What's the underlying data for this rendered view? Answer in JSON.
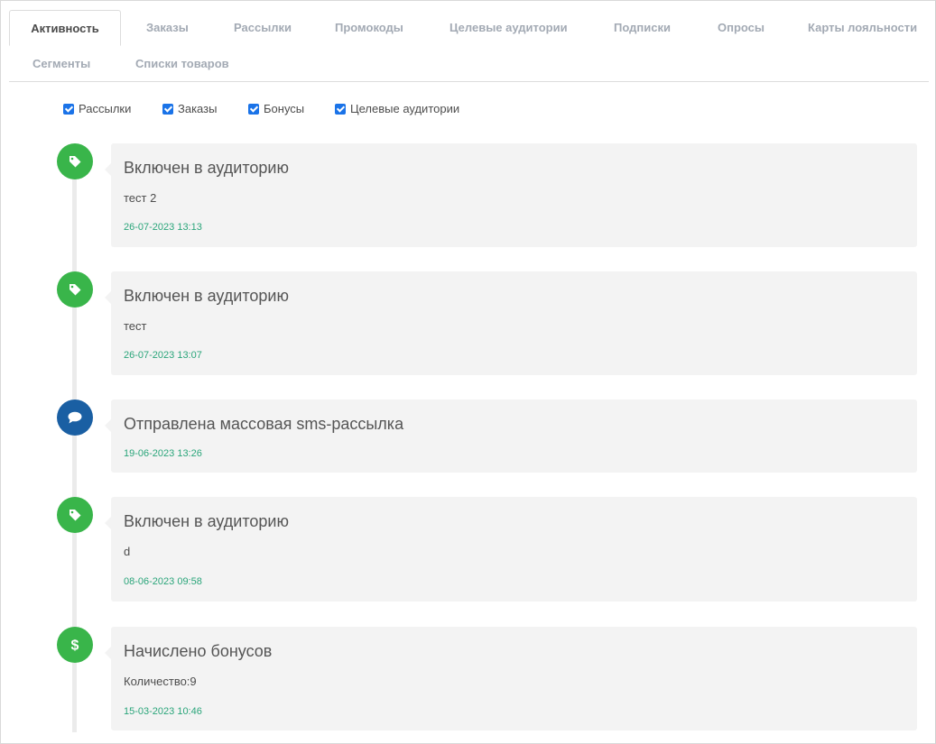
{
  "tabs": [
    {
      "label": "Активность",
      "active": true
    },
    {
      "label": "Заказы",
      "active": false
    },
    {
      "label": "Рассылки",
      "active": false
    },
    {
      "label": "Промокоды",
      "active": false
    },
    {
      "label": "Целевые аудитории",
      "active": false
    },
    {
      "label": "Подписки",
      "active": false
    },
    {
      "label": "Опросы",
      "active": false
    },
    {
      "label": "Карты лояльности",
      "active": false
    },
    {
      "label": "Сегменты",
      "active": false
    },
    {
      "label": "Списки товаров",
      "active": false
    }
  ],
  "filters": [
    {
      "label": "Рассылки",
      "checked": true
    },
    {
      "label": "Заказы",
      "checked": true
    },
    {
      "label": "Бонусы",
      "checked": true
    },
    {
      "label": "Целевые аудитории",
      "checked": true
    }
  ],
  "events": [
    {
      "icon": "tag-icon",
      "color": "#39b54a",
      "title": "Включен в аудиторию",
      "body": "тест 2",
      "time": "26-07-2023 13:13"
    },
    {
      "icon": "tag-icon",
      "color": "#39b54a",
      "title": "Включен в аудиторию",
      "body": "тест",
      "time": "26-07-2023 13:07"
    },
    {
      "icon": "chat-bubble-icon",
      "color": "#1a5fa3",
      "title": "Отправлена массовая sms-рассылка",
      "body": "",
      "time": "19-06-2023 13:26"
    },
    {
      "icon": "tag-icon",
      "color": "#39b54a",
      "title": "Включен в аудиторию",
      "body": "d",
      "time": "08-06-2023 09:58"
    },
    {
      "icon": "dollar-icon",
      "color": "#39b54a",
      "title": "Начислено бонусов",
      "body": "Количество:9",
      "time": "15-03-2023 10:46"
    }
  ]
}
